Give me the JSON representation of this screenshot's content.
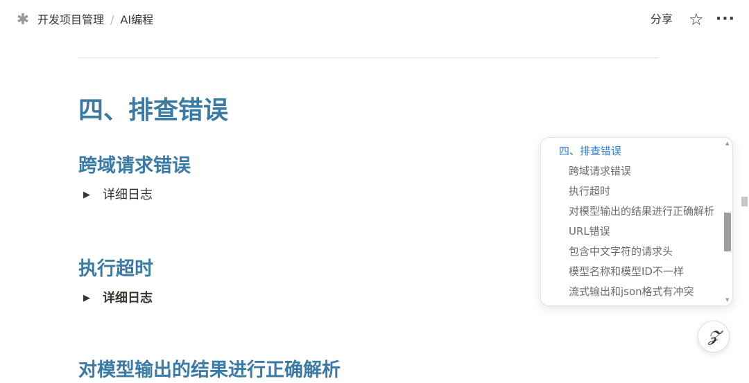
{
  "breadcrumb": {
    "icon": "asterisk-icon",
    "items": [
      "开发项目管理",
      "AI编程"
    ],
    "separator": "/"
  },
  "topbar": {
    "share_label": "分享",
    "star_icon": "star-icon",
    "more_icon": "more-icon"
  },
  "content": {
    "section_title": "四、排查错误",
    "sections": [
      {
        "title": "跨域请求错误",
        "toggle_label": "详细日志"
      },
      {
        "title": "执行超时",
        "toggle_label": "详细日志"
      }
    ],
    "clipped_heading": "对模型输出的结果进行正确解析"
  },
  "toc": {
    "items": [
      {
        "label": "四、排查错误",
        "level": 1,
        "active": true
      },
      {
        "label": "跨域请求错误",
        "level": 2
      },
      {
        "label": "执行超时",
        "level": 2
      },
      {
        "label": "对模型输出的结果进行正确解析",
        "level": 2
      },
      {
        "label": "URL错误",
        "level": 2
      },
      {
        "label": "包含中文字符的请求头",
        "level": 2
      },
      {
        "label": "模型名称和模型ID不一样",
        "level": 2
      },
      {
        "label": "流式输出和json格式有冲突",
        "level": 2
      }
    ]
  },
  "fab": {
    "glyph": "𝓩",
    "icon": "ai-assistant-icon"
  },
  "colors": {
    "heading": "#3a7aa6",
    "toc_active": "#2e7ed8",
    "text": "#37352f"
  }
}
